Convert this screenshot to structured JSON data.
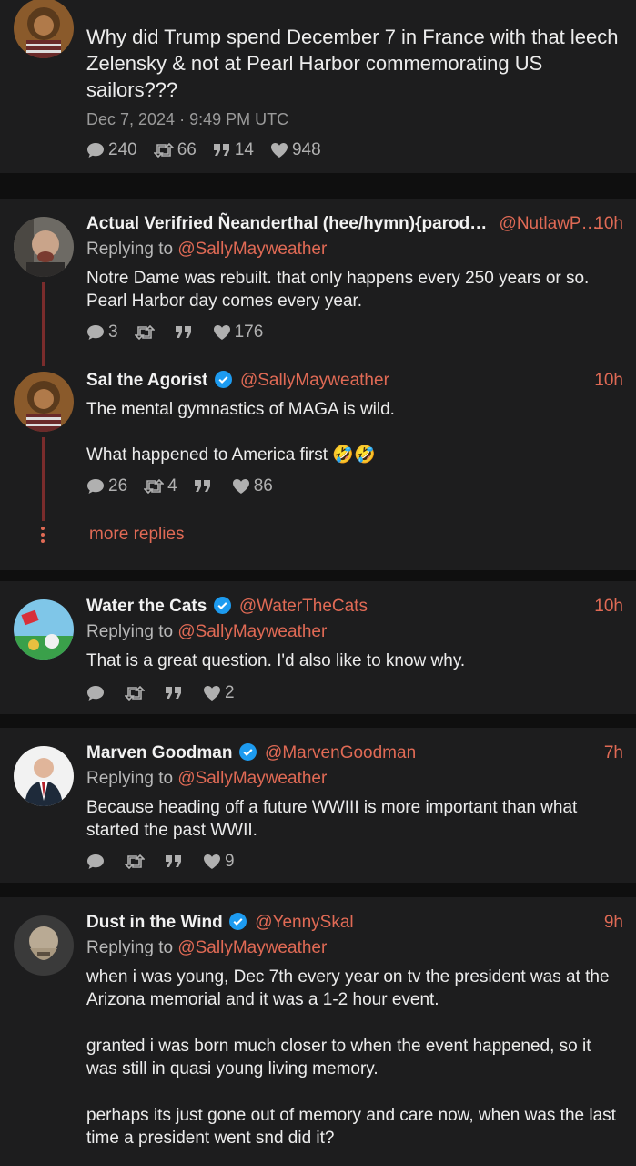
{
  "main_post": {
    "text": "Why did Trump spend December 7 in France with that leech Zelensky & not at Pearl Harbor commemorating US sailors???",
    "timestamp": "Dec 7, 2024 · 9:49 PM UTC",
    "stats": {
      "replies": "240",
      "retweets": "66",
      "quotes": "14",
      "likes": "948"
    }
  },
  "replies": [
    {
      "name": "Actual Verifried Ñeanderthal (hee/hymn){parod…",
      "handle": "@NutlawP…",
      "time": "10h",
      "replying_label": "Replying to",
      "replying_to": "@SallyMayweather",
      "text": "Notre Dame was rebuilt. that only happens every 250 years or so. Pearl Harbor day comes every year.",
      "stats": {
        "replies": "3",
        "retweets": "",
        "quotes": "",
        "likes": "176"
      }
    },
    {
      "name": "Sal the Agorist",
      "handle": "@SallyMayweather",
      "time": "10h",
      "text_line1": "The mental gymnastics of MAGA is wild.",
      "text_line2": "What happened to America first 🤣🤣",
      "stats": {
        "replies": "26",
        "retweets": "4",
        "quotes": "",
        "likes": "86"
      }
    },
    {
      "more_label": "more replies"
    },
    {
      "name": "Water the Cats",
      "handle": "@WaterTheCats",
      "time": "10h",
      "replying_label": "Replying to",
      "replying_to": "@SallyMayweather",
      "text": "That is a great question. I'd also like to know why.",
      "stats": {
        "replies": "",
        "retweets": "",
        "quotes": "",
        "likes": "2"
      }
    },
    {
      "name": "Marven Goodman",
      "handle": "@MarvenGoodman",
      "time": "7h",
      "replying_label": "Replying to",
      "replying_to": "@SallyMayweather",
      "text": "Because heading off a future WWIII is more important than what started the past WWII.",
      "stats": {
        "replies": "",
        "retweets": "",
        "quotes": "",
        "likes": "9"
      }
    },
    {
      "name": "Dust in the Wind",
      "handle": "@YennySkal",
      "time": "9h",
      "replying_label": "Replying to",
      "replying_to": "@SallyMayweather",
      "p1": "when i was young, Dec 7th every year on tv the president was at the Arizona memorial and it was a 1-2 hour event.",
      "p2": "granted i was born much closer to when the event happened, so it was still in quasi young living memory.",
      "p3": "perhaps its just gone out of memory and care now, when was the last time a president went snd did it?"
    }
  ],
  "colors": {
    "accent": "#e06a55",
    "verified": "#1d9bf0",
    "card": "#1d1d1e",
    "background": "#0f0f0f"
  }
}
